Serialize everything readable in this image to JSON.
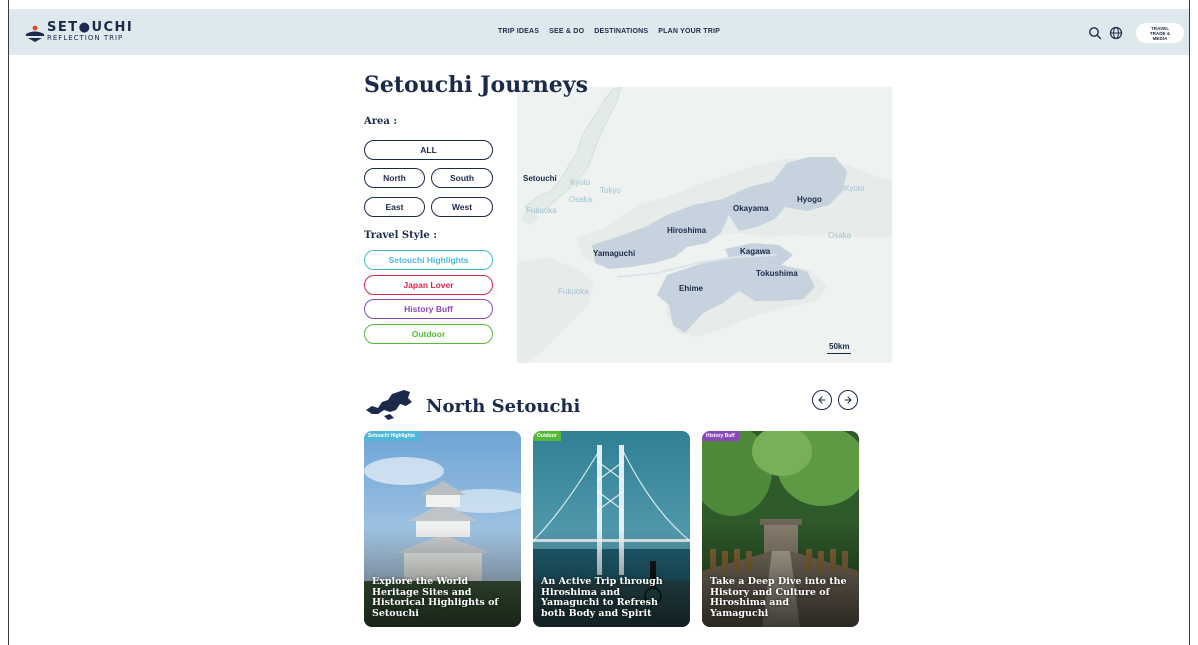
{
  "header": {
    "logo_word": "SET●UCHI",
    "logo_sub": "REFLECTION TRIP",
    "nav": [
      "TRIP IDEAS",
      "SEE & DO",
      "DESTINATIONS",
      "PLAN YOUR TRIP"
    ],
    "media_button": "TRAVEL TRADE & MEDIA",
    "icons": {
      "search": "search-icon",
      "language": "globe-icon"
    }
  },
  "page": {
    "title": "Setouchi Journeys"
  },
  "filters": {
    "area_label": "Area :",
    "area_options": [
      "ALL",
      "North",
      "South",
      "East",
      "West"
    ],
    "style_label": "Travel Style :",
    "style_options": [
      "Setouchi Highlights",
      "Japan Lover",
      "History Buff",
      "Outdoor"
    ]
  },
  "map": {
    "inset_labels": [
      "Setouchi",
      "Kyoto",
      "Tokyo",
      "Osaka",
      "Fukuoka"
    ],
    "region_labels": [
      "Hiroshima",
      "Okayama",
      "Hyogo",
      "Yamaguchi",
      "Kagawa",
      "Tokushima",
      "Ehime"
    ],
    "edge_labels": [
      "Kyoto",
      "Osaka",
      "Fukuoka"
    ],
    "scale": "50km"
  },
  "section": {
    "title": "North Setouchi",
    "icons": {
      "prev": "arrow-left-icon",
      "next": "arrow-right-icon"
    }
  },
  "cards": [
    {
      "tag": "Setouchi Highlights",
      "title": "Explore the World Heritage Sites and Historical Highlights of Setouchi",
      "tag_color": "#4fb8d8"
    },
    {
      "tag": "Outdoor",
      "title": "An Active Trip through Hiroshima and Yamaguchi to Refresh both Body and Spirit",
      "tag_color": "#58b83a"
    },
    {
      "tag": "History Buff",
      "title": "Take a Deep Dive into the History and Culture of Hiroshima and Yamaguchi",
      "tag_color": "#8a48b8"
    }
  ],
  "colors": {
    "navy": "#1b2a4a",
    "header_bg": "#dde9ec",
    "highlights": "#4fb8d8",
    "japan_lover": "#d8264b",
    "history_buff": "#8a48b8",
    "outdoor": "#58b83a"
  }
}
